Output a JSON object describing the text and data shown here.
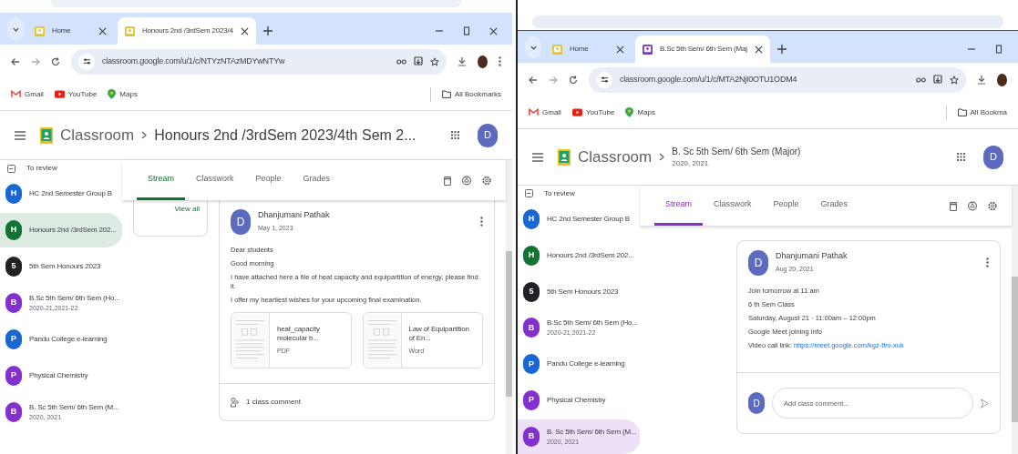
{
  "panes": [
    {
      "browser": {
        "tabs": [
          {
            "title": "Home",
            "color": "#e5c32a",
            "selected": false
          },
          {
            "title": "Honours 2nd /3rdSem 2023/4",
            "color": "#e5c32a",
            "selected": true
          }
        ],
        "close_button": true,
        "url": "classroom.google.com/u/1/c/NTYzNTAzMDYwNTYw",
        "menu_button": true,
        "bookmarks": [
          {
            "kind": "mail",
            "label": "Gmail"
          },
          {
            "kind": "video",
            "label": "YouTube"
          },
          {
            "kind": "map",
            "label": "Maps"
          }
        ],
        "all_bookmarks": "All Bookmarks"
      },
      "classroom": {
        "header": {
          "app": "Classroom",
          "title": "Honours 2nd /3rdSem 2023/4th Sem 2...",
          "avatar": "D"
        },
        "sidebar": {
          "review": "To review",
          "classes": [
            {
              "initial": "H",
              "name": "HC 2nd Semester Group B",
              "color": "#1967d2",
              "selected": false
            },
            {
              "initial": "H",
              "name": "Honours 2nd /3rdSem 202...",
              "color": "#137333",
              "selected": true
            },
            {
              "initial": "5",
              "name": "5th Sem Honours 2023",
              "color": "#202124",
              "selected": false
            },
            {
              "initial": "B",
              "name": "B.Sc 5th Sem/ 6th Sem (Ho...",
              "sub": "2020-21,2021-22",
              "color": "#8430ce",
              "selected": false
            },
            {
              "initial": "P",
              "name": "Pandu College e-learning",
              "color": "#1967d2",
              "selected": false
            },
            {
              "initial": "P",
              "name": "Physical Chemistry",
              "color": "#8430ce",
              "selected": false
            },
            {
              "initial": "B",
              "name": "B. Sc 5th Sem/ 6th Sem (M...",
              "sub": "2020, 2021",
              "color": "#8430ce",
              "selected": false
            }
          ]
        },
        "tabs": [
          {
            "label": "Stream",
            "selected": true
          },
          {
            "label": "Classwork",
            "selected": false
          },
          {
            "label": "People",
            "selected": false
          },
          {
            "label": "Grades",
            "selected": false
          }
        ],
        "upcoming": {
          "link": "View all"
        },
        "post": {
          "author": "Dhanjumani Pathak",
          "date": "May 1, 2023",
          "avatar": "D",
          "lines": [
            {
              "text": "Dear students"
            },
            {
              "text": "Good morning"
            },
            {
              "text": "I have attached here a file of heat capacity and equipartition of energy, please find it."
            },
            {
              "text": "I offer my heartiest wishes for your upcoming final examination."
            }
          ],
          "attachments": [
            {
              "title": "heat_capacity molecular b...",
              "type": "PDF"
            },
            {
              "title": "Law of Equipartition of En...",
              "type": "Word"
            }
          ],
          "comments": {
            "kind": "count",
            "text": "1 class comment"
          }
        }
      }
    },
    {
      "browser": {
        "tabs": [
          {
            "title": "Home",
            "color": "#e5c32a",
            "selected": false
          },
          {
            "title": "B.Sc 5th Sem/ 6th Sem (Maj",
            "color": "#8430ce",
            "selected": true
          }
        ],
        "close_button": false,
        "url": "classroom.google.com/u/1/c/MTA2NjI0OTU1ODM4",
        "menu_button": false,
        "bookmarks": [
          {
            "kind": "mail",
            "label": "Gmail"
          },
          {
            "kind": "video",
            "label": "YouTube"
          },
          {
            "kind": "map",
            "label": "Maps"
          }
        ],
        "all_bookmarks": "All Bookma"
      },
      "classroom": {
        "header": {
          "app": "Classroom",
          "title": "B. Sc 5th Sem/ 6th Sem (Major)",
          "subtitle": "2020, 2021",
          "avatar": "D"
        },
        "sidebar": {
          "review": "To review",
          "classes": [
            {
              "initial": "H",
              "name": "HC 2nd Semester Group B",
              "color": "#1967d2",
              "selected": false
            },
            {
              "initial": "H",
              "name": "Honours 2nd /3rdSem 202...",
              "color": "#137333",
              "selected": false
            },
            {
              "initial": "5",
              "name": "5th Sem Honours 2023",
              "color": "#202124",
              "selected": false
            },
            {
              "initial": "B",
              "name": "B.Sc 5th Sem/ 6th Sem (Ho...",
              "sub": "2020-21,2021-22",
              "color": "#8430ce",
              "selected": false
            },
            {
              "initial": "P",
              "name": "Pandu College e-learning",
              "color": "#1967d2",
              "selected": false
            },
            {
              "initial": "P",
              "name": "Physical Chemistry",
              "color": "#8430ce",
              "selected": false
            },
            {
              "initial": "B",
              "name": "B. Sc 5th Sem/ 6th Sem (M...",
              "sub": "2020, 2021",
              "color": "#8430ce",
              "selected": true
            }
          ]
        },
        "tabs": [
          {
            "label": "Stream",
            "selected": true
          },
          {
            "label": "Classwork",
            "selected": false
          },
          {
            "label": "People",
            "selected": false
          },
          {
            "label": "Grades",
            "selected": false
          }
        ],
        "post": {
          "author": "Dhanjumani Pathak",
          "date": "Aug 20, 2021",
          "avatar": "D",
          "lines": [
            {
              "text": "Join tomorrow at 11 am"
            },
            {
              "text": "6 th Sem Class"
            },
            {
              "text": "Saturday, August 21 · 11:00am – 12:00pm"
            },
            {
              "text": "Google Meet joining info"
            },
            {
              "text": "Video call link: ",
              "link": "https://meet.google.com/kgz-tfrv-xuk"
            }
          ],
          "comments": {
            "kind": "input",
            "placeholder": "Add class comment...",
            "avatar": "D"
          }
        }
      }
    }
  ]
}
